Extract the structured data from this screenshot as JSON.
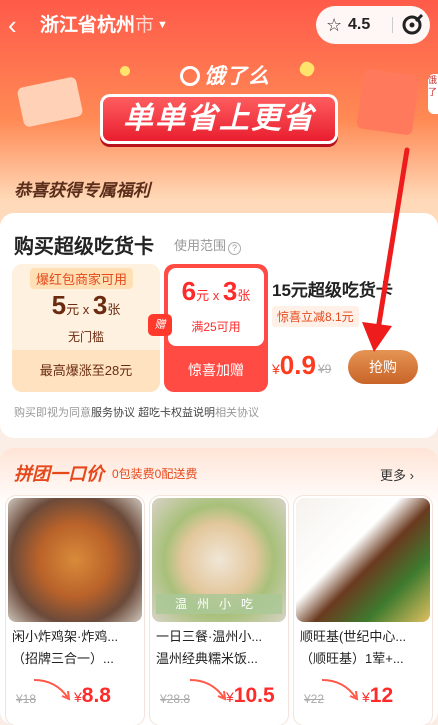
{
  "topbar": {
    "back_icon": "‹",
    "city": "浙江省杭州",
    "city_suffix": "市",
    "caret": "▼",
    "star_icon": "☆",
    "rating": "4.5"
  },
  "hero": {
    "logo": "饿了么",
    "slogan": "单单省上更省",
    "side_tab": "饿了"
  },
  "welfare": {
    "title": "恭喜获得专属福利",
    "card_title": "购买超级吃货卡",
    "range_label": "使用范围",
    "range_q": "?",
    "coupon1": {
      "tag": "爆红包商家可用",
      "amount": "5",
      "unit": "元",
      "times": "x",
      "count": "3",
      "count_unit": "张",
      "condition": "无门槛",
      "footer": "最高爆涨至28元"
    },
    "gift_tag": "赠",
    "coupon2": {
      "amount": "6",
      "unit": "元",
      "times": "x",
      "count": "3",
      "count_unit": "张",
      "condition": "满25可用",
      "footer": "惊喜加赠"
    },
    "product_name": "15元超级吃货卡",
    "product_save": "惊喜立减8.1元",
    "price_symbol": "¥",
    "price_now": "0.9",
    "price_old": "¥9",
    "buy_label": "抢购",
    "agree_prefix": "购买即视为同意",
    "agree_link1": "服务协议",
    "agree_link2": "超吃卡权益说明",
    "agree_suffix": "相关协议"
  },
  "group": {
    "title": "拼团一口价",
    "subtitle": "0包装费0配送费",
    "more": "更多 ›",
    "items": [
      {
        "name1": "闲小炸鸡架·炸鸡...",
        "name2": "（招牌三合一）...",
        "old": "¥18",
        "symbol": "¥",
        "price": "8.8"
      },
      {
        "name1": "一日三餐·温州小...",
        "name2": "温州经典糯米饭...",
        "old": "¥28.8",
        "symbol": "¥",
        "price": "10.5",
        "ribbon": "温州小吃"
      },
      {
        "name1": "顺旺基(世纪中心...",
        "name2": "（顺旺基）1荤+...",
        "old": "¥22",
        "symbol": "¥",
        "price": "12"
      }
    ]
  },
  "colors": {
    "brand_red": "#ff3b1f",
    "buy_button": "#d4762f",
    "group_accent": "#e5481b"
  }
}
